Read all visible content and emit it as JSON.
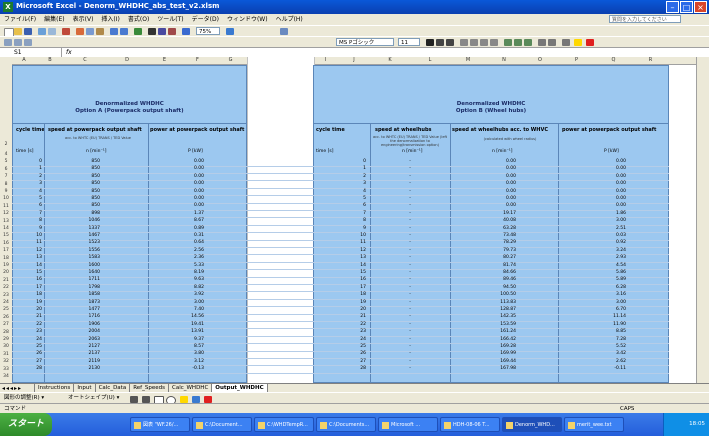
{
  "window": {
    "title": "Microsoft Excel - Denorm_WHDHC_abs_test_v2.xlsm",
    "app_icon": "X"
  },
  "menu": [
    "ファイル(F)",
    "編集(E)",
    "表示(V)",
    "挿入(I)",
    "書式(O)",
    "ツール(T)",
    "データ(D)",
    "ウィンドウ(W)",
    "ヘルプ(H)"
  ],
  "help_search_placeholder": "質問を入力してください",
  "toolbar": {
    "zoom": "75%",
    "font": "MS Pゴシック",
    "font_size": "11"
  },
  "formula_bar": {
    "name_box": "S1",
    "fx": "fx"
  },
  "columns": [
    "A",
    "B",
    "C",
    "D",
    "E",
    "F",
    "G",
    "H",
    "I",
    "J",
    "K",
    "L",
    "M",
    "N",
    "O",
    "P",
    "Q",
    "R"
  ],
  "sheet": {
    "left_title": "Denormalized WHDHC",
    "left_subtitle": "Option A (Powerpack output shaft)",
    "right_title": "Denormalized WHDHC",
    "right_subtitle": "Option B (Wheel hubs)",
    "header_row_num": "2",
    "left_cols": {
      "time": "cycle time",
      "speed": "speed at powerpack output shaft",
      "power": "power at powerpack output shaft"
    },
    "right_cols": {
      "time": "cycle time",
      "speed": "speed at wheelhubs",
      "speed2": "speed at wheelhubs acc. to WHVC",
      "power": "power at powerpack output shaft"
    },
    "left_note": "acc. to WHTC (EU) TRANS / TED Value",
    "right_note": "acc. to WHTC (EU) TRANS / TED Value (left the denormalization to engineering/transmission option)",
    "right_note2": "(calculated with wheel radius)",
    "units": {
      "time": "time [s]",
      "speed": "n [min⁻¹]",
      "power": "P [kW]"
    },
    "row_numbers": [
      "4",
      "5",
      "6",
      "7",
      "8",
      "9",
      "10",
      "11",
      "12",
      "13",
      "14",
      "15",
      "16",
      "17",
      "18",
      "19",
      "20",
      "21",
      "22",
      "23",
      "24",
      "25",
      "26",
      "27",
      "28",
      "29",
      "30",
      "31",
      "32",
      "33",
      "34",
      "35",
      "36"
    ],
    "rows": [
      {
        "t": "0",
        "n": "850",
        "p": "0.00",
        "t2": "0",
        "n2": "-",
        "v": "0.00",
        "p2": "0.00"
      },
      {
        "t": "1",
        "n": "850",
        "p": "0.00",
        "t2": "1",
        "n2": "-",
        "v": "0.00",
        "p2": "0.00"
      },
      {
        "t": "2",
        "n": "850",
        "p": "0.00",
        "t2": "2",
        "n2": "-",
        "v": "0.00",
        "p2": "0.00"
      },
      {
        "t": "3",
        "n": "850",
        "p": "0.00",
        "t2": "3",
        "n2": "-",
        "v": "0.00",
        "p2": "0.00"
      },
      {
        "t": "4",
        "n": "850",
        "p": "0.00",
        "t2": "4",
        "n2": "-",
        "v": "0.00",
        "p2": "0.00"
      },
      {
        "t": "5",
        "n": "850",
        "p": "0.00",
        "t2": "5",
        "n2": "-",
        "v": "0.00",
        "p2": "0.00"
      },
      {
        "t": "6",
        "n": "850",
        "p": "0.00",
        "t2": "6",
        "n2": "-",
        "v": "0.00",
        "p2": "0.00"
      },
      {
        "t": "7",
        "n": "898",
        "p": "1.37",
        "t2": "7",
        "n2": "-",
        "v": "19.17",
        "p2": "1.86"
      },
      {
        "t": "8",
        "n": "1046",
        "p": "8.67",
        "t2": "8",
        "n2": "-",
        "v": "40.08",
        "p2": "3.00"
      },
      {
        "t": "9",
        "n": "1337",
        "p": "0.89",
        "t2": "9",
        "n2": "-",
        "v": "63.28",
        "p2": "2.51"
      },
      {
        "t": "10",
        "n": "1467",
        "p": "0.31",
        "t2": "10",
        "n2": "-",
        "v": "73.48",
        "p2": "0.03"
      },
      {
        "t": "11",
        "n": "1523",
        "p": "0.64",
        "t2": "11",
        "n2": "-",
        "v": "78.29",
        "p2": "0.92"
      },
      {
        "t": "12",
        "n": "1556",
        "p": "2.56",
        "t2": "12",
        "n2": "-",
        "v": "79.73",
        "p2": "3.24"
      },
      {
        "t": "13",
        "n": "1583",
        "p": "2.36",
        "t2": "13",
        "n2": "-",
        "v": "80.27",
        "p2": "2.93"
      },
      {
        "t": "14",
        "n": "1600",
        "p": "5.33",
        "t2": "14",
        "n2": "-",
        "v": "81.74",
        "p2": "4.54"
      },
      {
        "t": "15",
        "n": "1640",
        "p": "8.19",
        "t2": "15",
        "n2": "-",
        "v": "84.66",
        "p2": "5.86"
      },
      {
        "t": "16",
        "n": "1711",
        "p": "9.63",
        "t2": "16",
        "n2": "-",
        "v": "89.46",
        "p2": "5.89"
      },
      {
        "t": "17",
        "n": "1798",
        "p": "8.82",
        "t2": "17",
        "n2": "-",
        "v": "94.50",
        "p2": "6.28"
      },
      {
        "t": "18",
        "n": "1858",
        "p": "3.92",
        "t2": "18",
        "n2": "-",
        "v": "100.50",
        "p2": "3.16"
      },
      {
        "t": "19",
        "n": "1873",
        "p": "3.00",
        "t2": "19",
        "n2": "-",
        "v": "113.83",
        "p2": "3.00"
      },
      {
        "t": "20",
        "n": "1477",
        "p": "7.40",
        "t2": "20",
        "n2": "-",
        "v": "128.87",
        "p2": "6.70"
      },
      {
        "t": "21",
        "n": "1716",
        "p": "14.56",
        "t2": "21",
        "n2": "-",
        "v": "142.35",
        "p2": "11.14"
      },
      {
        "t": "22",
        "n": "1906",
        "p": "19.41",
        "t2": "22",
        "n2": "-",
        "v": "153.59",
        "p2": "11.90"
      },
      {
        "t": "23",
        "n": "2004",
        "p": "13.91",
        "t2": "23",
        "n2": "-",
        "v": "161.24",
        "p2": "8.85"
      },
      {
        "t": "24",
        "n": "2063",
        "p": "9.37",
        "t2": "24",
        "n2": "-",
        "v": "166.42",
        "p2": "7.28"
      },
      {
        "t": "25",
        "n": "2127",
        "p": "8.57",
        "t2": "25",
        "n2": "-",
        "v": "169.28",
        "p2": "5.52"
      },
      {
        "t": "26",
        "n": "2137",
        "p": "3.80",
        "t2": "26",
        "n2": "-",
        "v": "169.99",
        "p2": "3.42"
      },
      {
        "t": "27",
        "n": "2119",
        "p": "3.12",
        "t2": "27",
        "n2": "-",
        "v": "169.44",
        "p2": "2.62"
      },
      {
        "t": "28",
        "n": "2130",
        "p": "-0.13",
        "t2": "28",
        "n2": "-",
        "v": "167.98",
        "p2": "-0.11"
      }
    ]
  },
  "tabs": [
    "Instructions",
    "Input",
    "Calc_Data",
    "Ref_Speeds",
    "Calc_WHDHC",
    "Output_WHDHC"
  ],
  "active_tab": "Output_WHDHC",
  "drawbar": {
    "draw": "図形の調整(R) ▾",
    "autoshape": "オートシェイプ(U) ▾"
  },
  "status": {
    "left": "コマンド",
    "caps": "CAPS"
  },
  "taskbar": {
    "start": "スタート",
    "items": [
      "図表 \"WF.26/...",
      "C:\\Document...",
      "C:\\WHDTempR...",
      "C:\\Documents...",
      "Microsoft ...",
      "HDH-08-06 T...",
      "Denorm_WHD...",
      "merit_wee.txt"
    ],
    "clock": "18:05"
  }
}
